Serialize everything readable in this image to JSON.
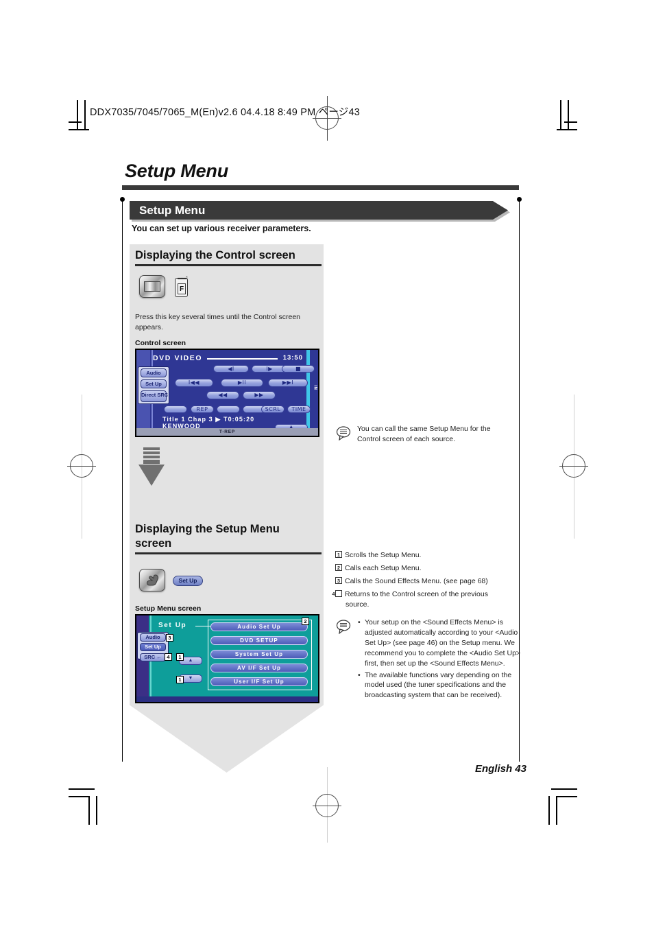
{
  "print_header": "DDX7035/7045/7065_M(En)v2.6  04.4.18  8:49 PM  ページ43",
  "page_title": "Setup Menu",
  "banner": {
    "label": "Setup Menu",
    "subtitle": "You can set up various receiver parameters."
  },
  "section_control": {
    "heading": "Displaying the Control screen",
    "instruction": "Press this key several times until the Control screen appears.",
    "caption": "Control screen",
    "remote_key_label": "F"
  },
  "control_screen": {
    "title": "DVD VIDEO",
    "time": "13:50",
    "side_buttons": [
      "Audio",
      "Set Up",
      "Direct SRC"
    ],
    "row1": [
      "◀I",
      "I▶",
      "■"
    ],
    "row2": [
      "I◀◀",
      "▶II",
      "▶▶I"
    ],
    "row3": [
      "◀◀",
      "▶▶"
    ],
    "row4": [
      "",
      "REP",
      "",
      "",
      "SCRL",
      "TIME"
    ],
    "info_line": "Title 1   Chap    3   ▶   T0:05:20",
    "disc_label": "KENWOOD",
    "eject_label": "▲",
    "status_bar": "T-REP",
    "side_indicator": "IN"
  },
  "section_setup": {
    "heading": "Displaying the Setup Menu screen",
    "button_label": "Set Up",
    "caption": "Setup Menu screen"
  },
  "setup_screen": {
    "title": "Set Up",
    "menu_items": [
      "Audio Set Up",
      "DVD SETUP",
      "System Set Up",
      "AV I/F Set Up",
      "User I/F Set Up"
    ],
    "side_buttons": [
      "Audio",
      "Set Up",
      "SRC ←"
    ],
    "scroll_up": "▲",
    "scroll_down": "▼",
    "callouts": [
      "1",
      "2",
      "3",
      "4"
    ]
  },
  "note_control": "You can call the same Setup Menu for the Control screen of each source.",
  "numbered_notes": [
    {
      "num": "1",
      "text": "Scrolls the Setup Menu."
    },
    {
      "num": "2",
      "text": "Calls each Setup Menu."
    },
    {
      "num": "3",
      "text": "Calls the Sound Effects Menu. (see page 68)"
    },
    {
      "num": "4",
      "text": "Returns to the Control screen of the previous source."
    }
  ],
  "bullet_notes": [
    "Your setup on the <Sound Effects Menu> is adjusted automatically according to your <Audio Set Up> (see page 46) on the Setup menu. We recommend you to complete the <Audio Set Up> first, then set up the <Sound Effects Menu>.",
    "The available functions vary depending on the model used (the tuner specifications and the broadcasting system that can be received)."
  ],
  "footer": "English 43"
}
